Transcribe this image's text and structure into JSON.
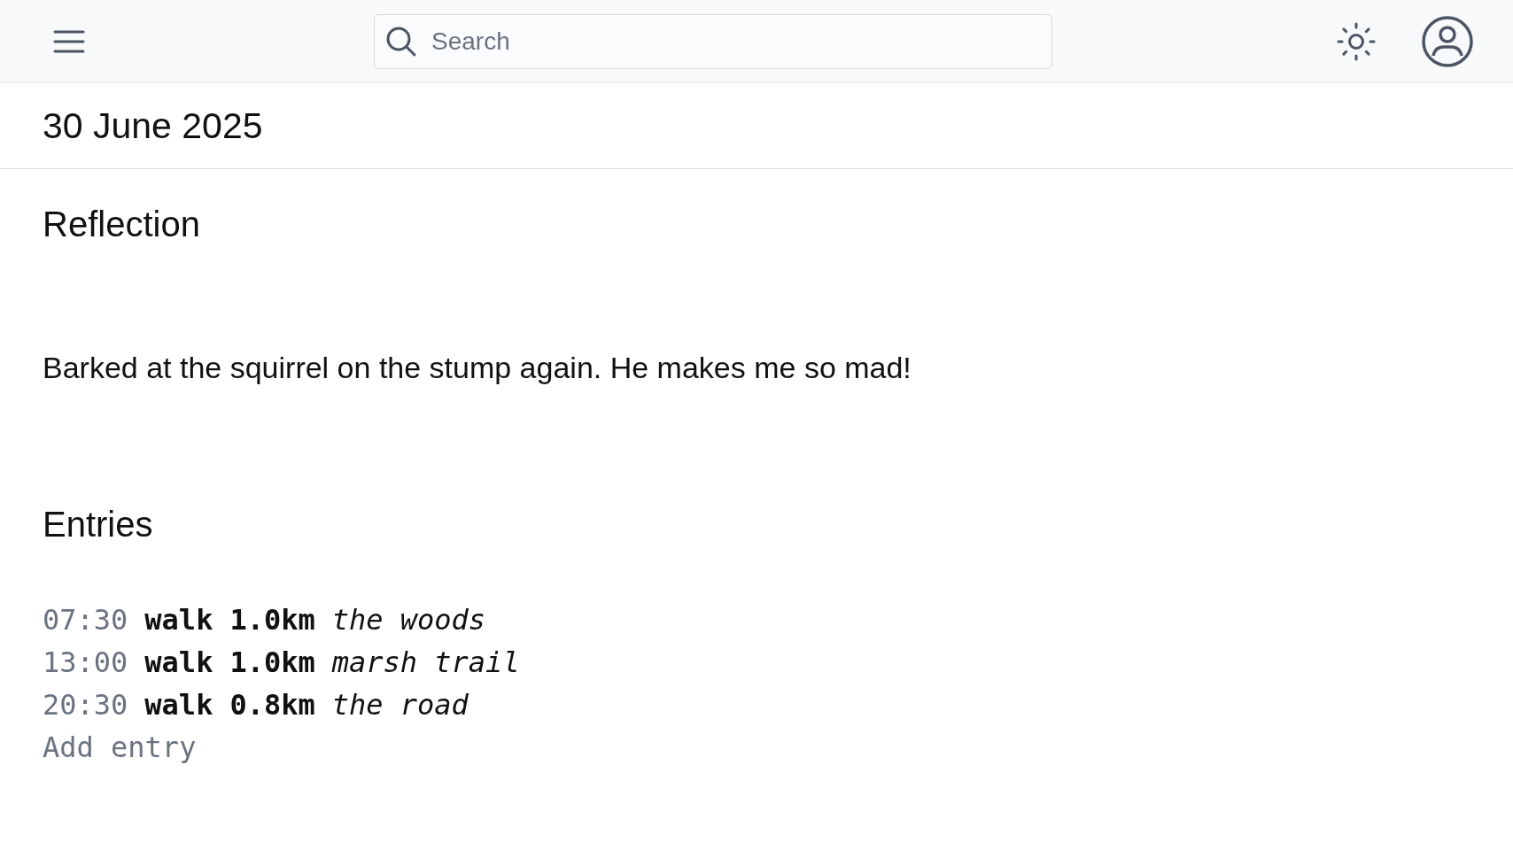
{
  "search": {
    "placeholder": "Search"
  },
  "date": "30 June 2025",
  "reflection": {
    "heading": "Reflection",
    "text": "Barked at the squirrel on the stump again. He makes me so mad!"
  },
  "entries": {
    "heading": "Entries",
    "items": [
      {
        "time": "07:30",
        "activity": "walk",
        "distance": "1.0km",
        "place": "the woods"
      },
      {
        "time": "13:00",
        "activity": "walk",
        "distance": "1.0km",
        "place": "marsh trail"
      },
      {
        "time": "20:30",
        "activity": "walk",
        "distance": "0.8km",
        "place": "the road"
      }
    ],
    "add_entry": {
      "placeholder": "Add entry"
    }
  }
}
